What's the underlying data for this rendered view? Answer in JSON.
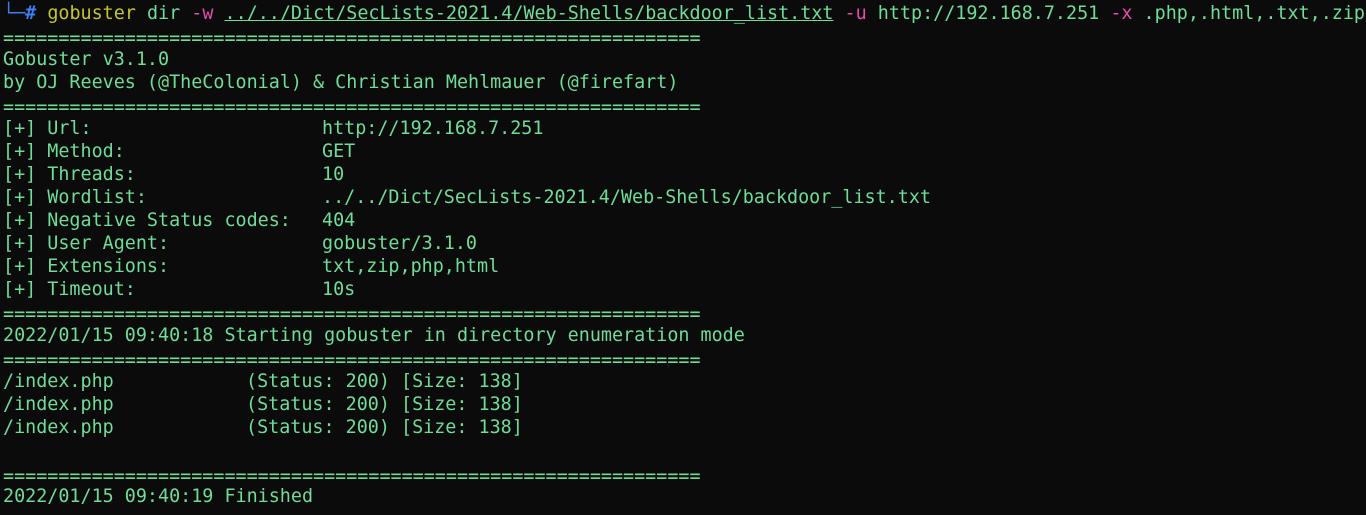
{
  "prompt": {
    "tree": "└─",
    "hash": "#",
    "command": "gobuster",
    "subcommand": "dir",
    "flag_w": "-w",
    "wordlist_path": "../../Dict/SecLists-2021.4/Web-Shells/backdoor_list.txt",
    "flag_u": "-u",
    "url": "http://192.168.7.251",
    "flag_x": "-x",
    "extensions": ".php,.html,.txt,.zip"
  },
  "separator": "===============================================================",
  "banner": {
    "title": "Gobuster v3.1.0",
    "authors": "by OJ Reeves (@TheColonial) & Christian Mehlmauer (@firefart)"
  },
  "config": [
    {
      "key": "[+] Url:",
      "value": "http://192.168.7.251"
    },
    {
      "key": "[+] Method:",
      "value": "GET"
    },
    {
      "key": "[+] Threads:",
      "value": "10"
    },
    {
      "key": "[+] Wordlist:",
      "value": "../../Dict/SecLists-2021.4/Web-Shells/backdoor_list.txt"
    },
    {
      "key": "[+] Negative Status codes:",
      "value": "404"
    },
    {
      "key": "[+] User Agent:",
      "value": "gobuster/3.1.0"
    },
    {
      "key": "[+] Extensions:",
      "value": "txt,zip,php,html"
    },
    {
      "key": "[+] Timeout:",
      "value": "10s"
    }
  ],
  "start_message": "2022/01/15 09:40:18 Starting gobuster in directory enumeration mode",
  "results": [
    {
      "path": "/index.php",
      "info": "(Status: 200) [Size: 138]"
    },
    {
      "path": "/index.php",
      "info": "(Status: 200) [Size: 138]"
    },
    {
      "path": "/index.php",
      "info": "(Status: 200) [Size: 138]"
    }
  ],
  "finish_message": "2022/01/15 09:40:19 Finished",
  "colors": {
    "background": "#0b0b0b",
    "output_green": "#6fdc98",
    "prompt_blue": "#3d7df0",
    "command_yellow": "#c5c52c",
    "flag_magenta": "#e64bb0"
  }
}
